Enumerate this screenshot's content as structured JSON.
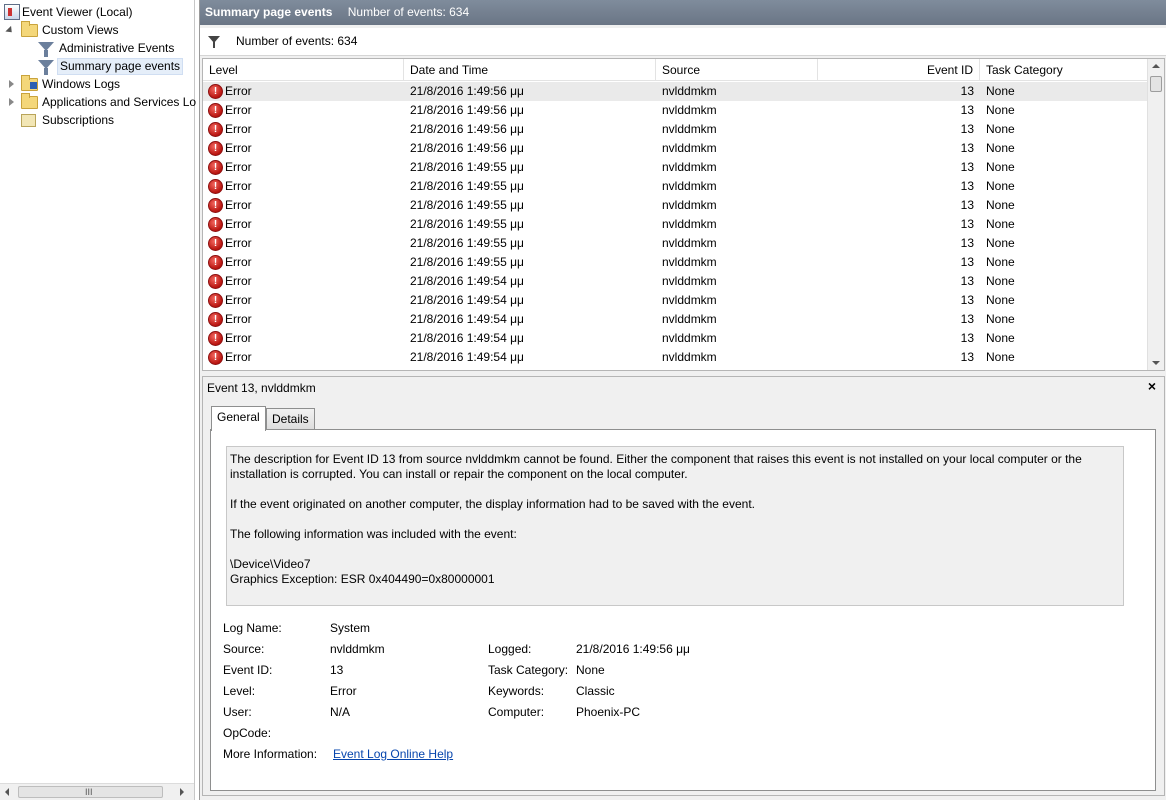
{
  "nav": {
    "root": "Event Viewer (Local)",
    "custom_views": "Custom Views",
    "administrative_events": "Administrative Events",
    "summary_page_events": "Summary page events",
    "windows_logs": "Windows Logs",
    "apps_services_logs": "Applications and Services Lo",
    "subscriptions": "Subscriptions",
    "scroll_grip": "III"
  },
  "header": {
    "title": "Summary page events",
    "count": "Number of events: 634"
  },
  "filter": {
    "count": "Number of events: 634"
  },
  "grid": {
    "columns": [
      "Level",
      "Date and Time",
      "Source",
      "Event ID",
      "Task Category"
    ],
    "rows": [
      {
        "level": "Error",
        "datetime": "21/8/2016 1:49:56 μμ",
        "source": "nvlddmkm",
        "event_id": "13",
        "task": "None"
      },
      {
        "level": "Error",
        "datetime": "21/8/2016 1:49:56 μμ",
        "source": "nvlddmkm",
        "event_id": "13",
        "task": "None"
      },
      {
        "level": "Error",
        "datetime": "21/8/2016 1:49:56 μμ",
        "source": "nvlddmkm",
        "event_id": "13",
        "task": "None"
      },
      {
        "level": "Error",
        "datetime": "21/8/2016 1:49:56 μμ",
        "source": "nvlddmkm",
        "event_id": "13",
        "task": "None"
      },
      {
        "level": "Error",
        "datetime": "21/8/2016 1:49:55 μμ",
        "source": "nvlddmkm",
        "event_id": "13",
        "task": "None"
      },
      {
        "level": "Error",
        "datetime": "21/8/2016 1:49:55 μμ",
        "source": "nvlddmkm",
        "event_id": "13",
        "task": "None"
      },
      {
        "level": "Error",
        "datetime": "21/8/2016 1:49:55 μμ",
        "source": "nvlddmkm",
        "event_id": "13",
        "task": "None"
      },
      {
        "level": "Error",
        "datetime": "21/8/2016 1:49:55 μμ",
        "source": "nvlddmkm",
        "event_id": "13",
        "task": "None"
      },
      {
        "level": "Error",
        "datetime": "21/8/2016 1:49:55 μμ",
        "source": "nvlddmkm",
        "event_id": "13",
        "task": "None"
      },
      {
        "level": "Error",
        "datetime": "21/8/2016 1:49:55 μμ",
        "source": "nvlddmkm",
        "event_id": "13",
        "task": "None"
      },
      {
        "level": "Error",
        "datetime": "21/8/2016 1:49:54 μμ",
        "source": "nvlddmkm",
        "event_id": "13",
        "task": "None"
      },
      {
        "level": "Error",
        "datetime": "21/8/2016 1:49:54 μμ",
        "source": "nvlddmkm",
        "event_id": "13",
        "task": "None"
      },
      {
        "level": "Error",
        "datetime": "21/8/2016 1:49:54 μμ",
        "source": "nvlddmkm",
        "event_id": "13",
        "task": "None"
      },
      {
        "level": "Error",
        "datetime": "21/8/2016 1:49:54 μμ",
        "source": "nvlddmkm",
        "event_id": "13",
        "task": "None"
      },
      {
        "level": "Error",
        "datetime": "21/8/2016 1:49:54 μμ",
        "source": "nvlddmkm",
        "event_id": "13",
        "task": "None"
      }
    ]
  },
  "detail": {
    "title": "Event 13, nvlddmkm",
    "close": "×",
    "tabs": [
      "General",
      "Details"
    ],
    "description": [
      "The description for Event ID 13 from source nvlddmkm cannot be found. Either the component that raises this event is not installed on your local computer or the installation is corrupted. You can install or repair the component on the local computer.",
      "If the event originated on another computer, the display information had to be saved with the event.",
      "The following information was included with the event:",
      "\\Device\\Video7",
      "Graphics Exception: ESR 0x404490=0x80000001"
    ],
    "labels": {
      "log_name": "Log Name:",
      "source": "Source:",
      "event_id": "Event ID:",
      "level": "Level:",
      "user": "User:",
      "opcode": "OpCode:",
      "more_info": "More Information:",
      "logged": "Logged:",
      "task_category": "Task Category:",
      "keywords": "Keywords:",
      "computer": "Computer:"
    },
    "values": {
      "log_name": "System",
      "source": "nvlddmkm",
      "event_id": "13",
      "level": "Error",
      "user": "N/A",
      "opcode": "",
      "more_info": "Event Log Online Help",
      "logged": "21/8/2016 1:49:56 μμ",
      "task_category": "None",
      "keywords": "Classic",
      "computer": "Phoenix-PC"
    }
  },
  "icons": {
    "error": "error-icon",
    "filter": "filter-icon",
    "folder": "folder-icon"
  },
  "colors": {
    "titlebar": "#707b8b",
    "error": "#c8201a",
    "link": "#0645ad",
    "selection": "#e5eef9"
  }
}
